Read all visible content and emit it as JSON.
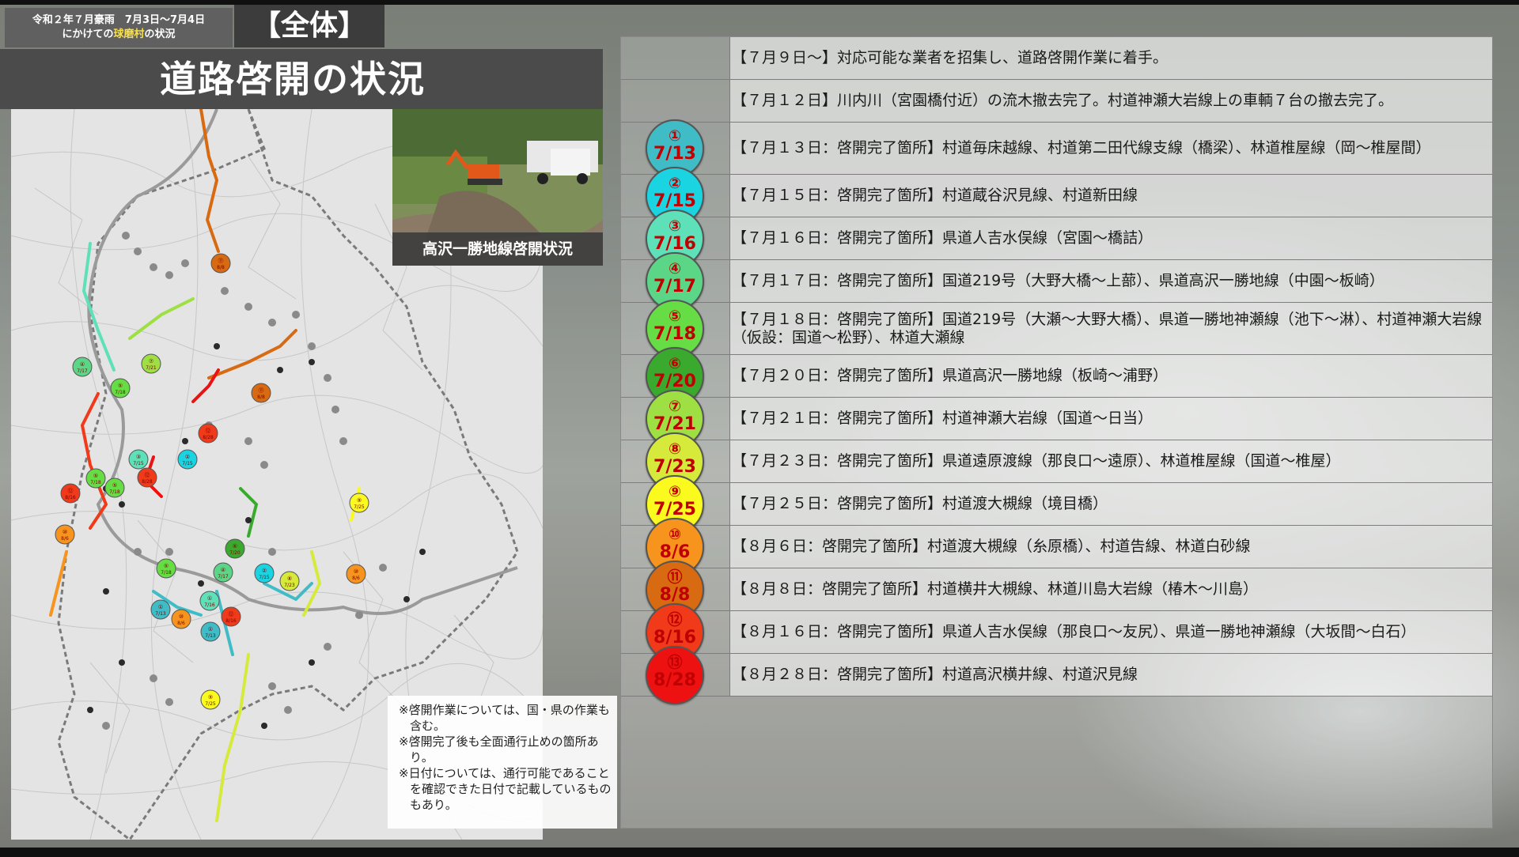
{
  "header": {
    "date_line1": "令和２年７月豪雨　7月3日〜7月4日",
    "date_line2_pre": "にかけての",
    "date_line2_hl": "球磨村",
    "date_line2_post": "の状況",
    "scope": "【全体】",
    "title": "道路啓開の状況"
  },
  "photo": {
    "caption": "高沢一勝地線啓開状況"
  },
  "notes": [
    "※啓開作業については、国・県の作業も含む。",
    "※啓開完了後も全面通行止めの箇所あり。",
    "※日付については、通行可能であることを確認できた日付で記載しているものもあり。"
  ],
  "rows": [
    {
      "text": "【７月９日〜】対応可能な業者を招集し、道路啓開作業に着手。"
    },
    {
      "text": "【７月１２日】川内川（宮園橋付近）の流木撤去完了。村道神瀬大岩線上の車輌７台の撤去完了。"
    },
    {
      "num": "①",
      "date": "7/13",
      "color": "#3fbcc6",
      "text": "【７月１３日：啓開完了箇所】村道毎床越線、村道第二田代線支線（橋梁）、林道椎屋線（岡〜椎屋間）"
    },
    {
      "num": "②",
      "date": "7/15",
      "color": "#1ad4e2",
      "text": "【７月１５日：啓開完了箇所】村道蔵谷沢見線、村道新田線"
    },
    {
      "num": "③",
      "date": "7/16",
      "color": "#5ee0b8",
      "text": "【７月１６日：啓開完了箇所】県道人吉水俣線（宮園〜橋詰）"
    },
    {
      "num": "④",
      "date": "7/17",
      "color": "#5ad686",
      "text": "【７月１７日：啓開完了箇所】国道219号（大野大橋〜上蔀）、県道高沢一勝地線（中園〜板崎）"
    },
    {
      "num": "⑤",
      "date": "7/18",
      "color": "#66dd44",
      "text": "【７月１８日：啓開完了箇所】国道219号（大瀬〜大野大橋）、県道一勝地神瀬線（池下〜淋）、村道神瀬大岩線（仮設：国道〜松野）、林道大瀬線"
    },
    {
      "num": "⑥",
      "date": "7/20",
      "color": "#3aaa2e",
      "text": "【７月２０日：啓開完了箇所】県道高沢一勝地線（板崎〜浦野）"
    },
    {
      "num": "⑦",
      "date": "7/21",
      "color": "#9ee044",
      "text": "【７月２１日：啓開完了箇所】村道神瀬大岩線（国道〜日当）"
    },
    {
      "num": "⑧",
      "date": "7/23",
      "color": "#d6ea3c",
      "text": "【７月２３日：啓開完了箇所】県道遠原渡線（那良口〜遠原）、林道椎屋線（国道〜椎屋）"
    },
    {
      "num": "⑨",
      "date": "7/25",
      "color": "#fafa1e",
      "text": "【７月２５日：啓開完了箇所】村道渡大槻線（境目橋）"
    },
    {
      "num": "⑩",
      "date": "8/6",
      "color": "#f7941d",
      "text": "【８月６日：啓開完了箇所】村道渡大槻線（糸原橋）、村道告線、林道白砂線"
    },
    {
      "num": "⑪",
      "date": "8/8",
      "color": "#d86a12",
      "text": "【８月８日：啓開完了箇所】村道横井大槻線、林道川島大岩線（椿木〜川島）"
    },
    {
      "num": "⑫",
      "date": "8/16",
      "color": "#f03a1a",
      "text": "【８月１６日：啓開完了箇所】県道人吉水俣線（那良口〜友尻）、県道一勝地神瀬線（大坂間〜白石）"
    },
    {
      "num": "⑬",
      "date": "8/28",
      "color": "#ee1111",
      "text": "【８月２８日：啓開完了箇所】村道高沢横井線、村道沢見線"
    }
  ],
  "map_markers": [
    {
      "label": "⑪\n8/8",
      "color": "#d86a12"
    },
    {
      "label": "④\n7/17",
      "color": "#5ad686"
    },
    {
      "label": "⑦\n7/21",
      "color": "#9ee044"
    },
    {
      "label": "⑤\n7/18",
      "color": "#66dd44"
    },
    {
      "label": "⑪\n8/8",
      "color": "#d86a12"
    },
    {
      "label": "⑫\n8/28",
      "color": "#f03a1a"
    },
    {
      "label": "③\n7/15",
      "color": "#5ee0b8"
    },
    {
      "label": "②\n7/15",
      "color": "#1ad4e2"
    },
    {
      "label": "⑫\n8/28",
      "color": "#f03a1a"
    },
    {
      "label": "⑤\n7/18",
      "color": "#66dd44"
    },
    {
      "label": "⑤\n7/18",
      "color": "#66dd44"
    },
    {
      "label": "⑫\n8/16",
      "color": "#f03a1a"
    },
    {
      "label": "⑨\n7/25",
      "color": "#fafa1e"
    },
    {
      "label": "⑩\n8/6",
      "color": "#f7941d"
    },
    {
      "label": "⑥\n7/20",
      "color": "#3aaa2e"
    },
    {
      "label": "⑤\n7/18",
      "color": "#66dd44"
    },
    {
      "label": "④\n7/17",
      "color": "#5ad686"
    },
    {
      "label": "②\n7/15",
      "color": "#1ad4e2"
    },
    {
      "label": "⑧\n7/23",
      "color": "#d6ea3c"
    },
    {
      "label": "⑩\n8/6",
      "color": "#f7941d"
    },
    {
      "label": "①\n7/16",
      "color": "#5ee0b8"
    },
    {
      "label": "①\n7/13",
      "color": "#3fbcc6"
    },
    {
      "label": "⑩\n8/6",
      "color": "#f7941d"
    },
    {
      "label": "⑫\n8/16",
      "color": "#f03a1a"
    },
    {
      "label": "①\n7/13",
      "color": "#3fbcc6"
    },
    {
      "label": "⑨\n7/25",
      "color": "#fafa1e"
    }
  ]
}
